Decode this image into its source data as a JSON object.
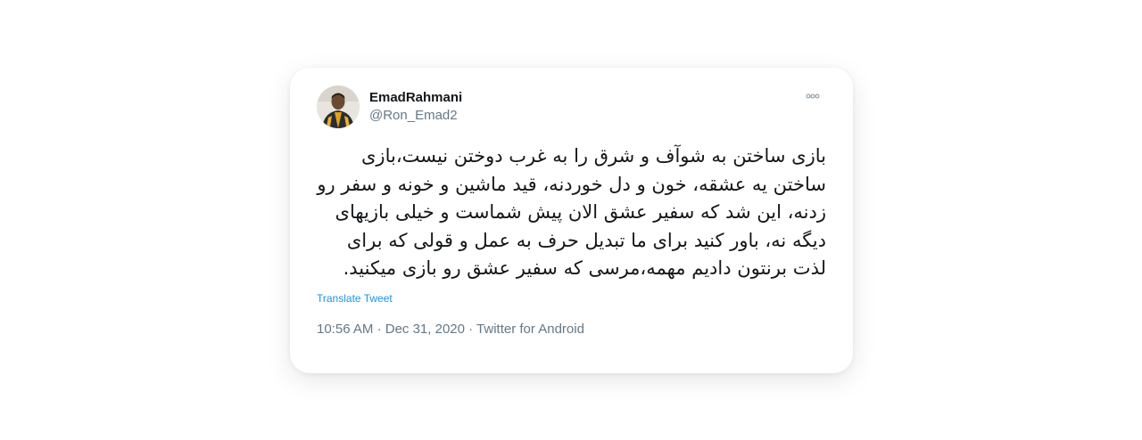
{
  "tweet": {
    "author": {
      "display_name": "EmadRahmani",
      "handle": "@Ron_Emad2",
      "avatar_icon": "profile-photo"
    },
    "more_icon": "more-horizontal-icon",
    "text": "بازی ساختن به شوآف و شرق را به غرب دوختن نیست،بازی ساختن یه عشقه، خون و دل خوردنه، قید ماشین و خونه و سفر رو زدنه، این شد که سفیر عشق الان پیش شماست و خیلی بازیهای دیگه نه، باور کنید برای ما تبدیل حرف به عمل و قولی که برای لذت برنتون دادیم مهمه،مرسی که سفیر عشق رو بازی میکنید.",
    "translate_label": "Translate Tweet",
    "time": "10:56 AM",
    "separator": "·",
    "date": "Dec 31, 2020",
    "source": "Twitter for Android",
    "colors": {
      "link": "#1b95e0",
      "secondary": "#657786",
      "primary": "#14171a"
    }
  }
}
